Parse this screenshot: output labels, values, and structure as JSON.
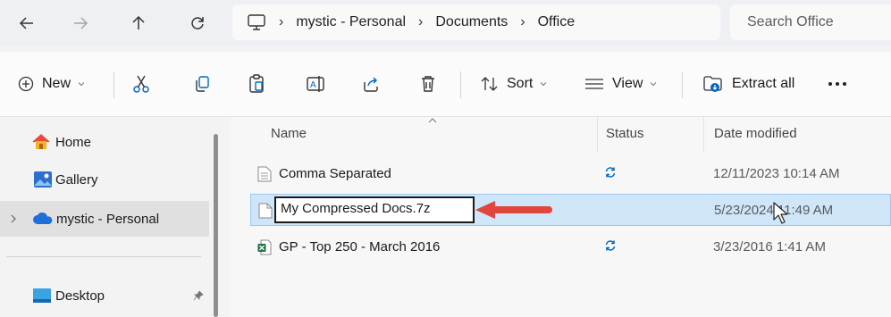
{
  "address_bar": {
    "back_icon": "arrow-left-icon",
    "forward_icon": "arrow-right-icon",
    "up_icon": "arrow-up-icon",
    "refresh_icon": "refresh-icon",
    "breadcrumb": [
      "mystic - Personal",
      "Documents",
      "Office"
    ],
    "search_placeholder": "Search Office"
  },
  "toolbar": {
    "new_label": "New",
    "sort_label": "Sort",
    "view_label": "View",
    "extract_label": "Extract all",
    "icons": [
      "cut-icon",
      "copy-icon",
      "paste-icon",
      "rename-icon",
      "share-icon",
      "delete-icon",
      "more-icon"
    ]
  },
  "nav": {
    "items": [
      {
        "label": "Home",
        "icon": "home-icon"
      },
      {
        "label": "Gallery",
        "icon": "gallery-icon"
      },
      {
        "label": "mystic - Personal",
        "icon": "cloud-icon"
      },
      {
        "label": "Desktop",
        "icon": "desktop-icon"
      }
    ]
  },
  "files": {
    "columns": [
      "Name",
      "Status",
      "Date modified"
    ],
    "rows": [
      {
        "name": "Comma Separated",
        "status": "sync-icon",
        "date": "12/11/2023 10:14 AM"
      },
      {
        "name": "My Compressed Docs.7z",
        "status": "",
        "date": "5/23/2024 11:49 AM"
      },
      {
        "name": "GP - Top 250 - March 2016",
        "status": "sync-icon",
        "date": "3/23/2016 1:41 AM"
      }
    ]
  },
  "colors": {
    "accent": "#0067c0",
    "selection": "#cfe5f8",
    "annotation_arrow": "#e0463c",
    "excel_green": "#1d6f42"
  }
}
